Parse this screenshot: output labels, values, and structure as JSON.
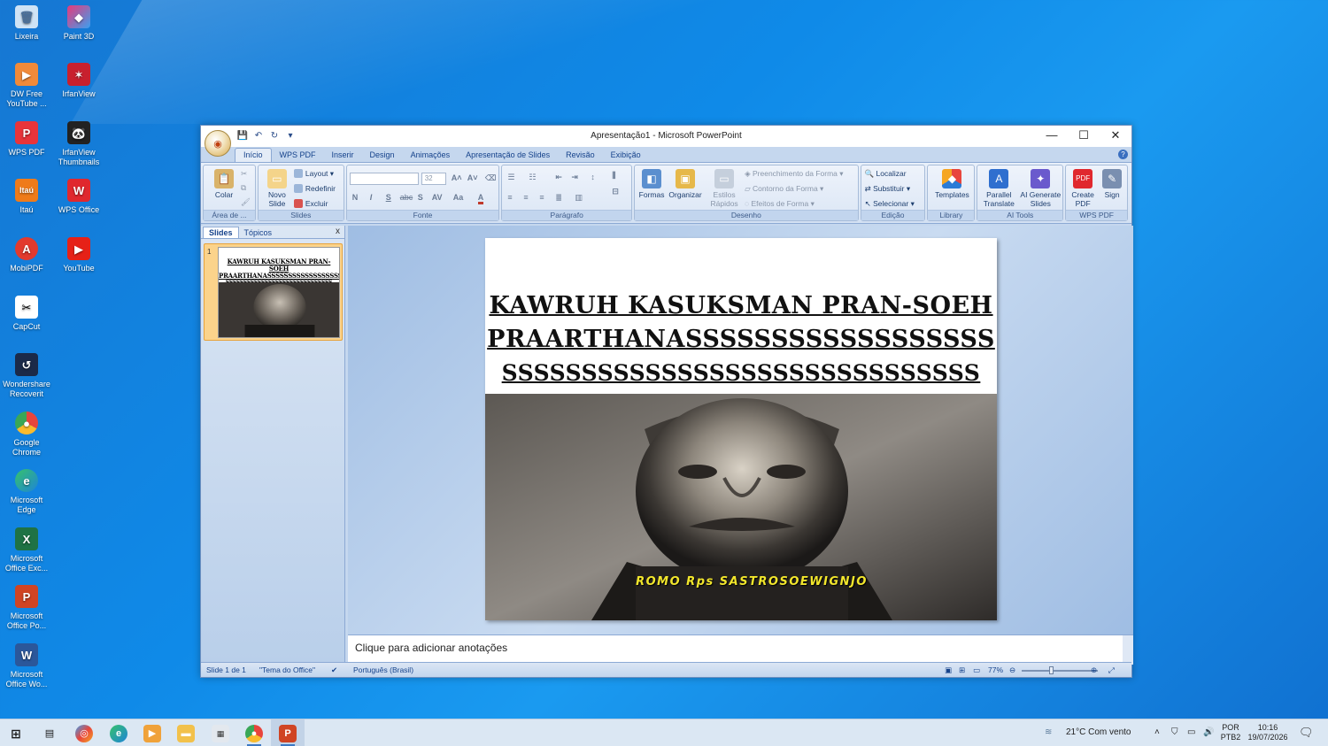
{
  "desktop": {
    "icons": [
      {
        "label": "Lixeira"
      },
      {
        "label": "Paint 3D"
      },
      {
        "label": "DW Free YouTube ..."
      },
      {
        "label": "IrfanView"
      },
      {
        "label": "WPS PDF"
      },
      {
        "label": "IrfanView Thumbnails"
      },
      {
        "label": "Itaú"
      },
      {
        "label": "WPS Office"
      },
      {
        "label": "MobiPDF"
      },
      {
        "label": "YouTube"
      },
      {
        "label": "CapCut"
      },
      {
        "label": "Wondershare Recoverit"
      },
      {
        "label": "Google Chrome"
      },
      {
        "label": "Microsoft Edge"
      },
      {
        "label": "Microsoft Office Exc..."
      },
      {
        "label": "Microsoft Office Po..."
      },
      {
        "label": "Microsoft Office Wo..."
      }
    ]
  },
  "window": {
    "title": "Apresentação1 - Microsoft PowerPoint",
    "controls": {
      "minimize": "—",
      "maximize": "☐",
      "close": "✕"
    }
  },
  "ribbon_tabs": [
    "Início",
    "WPS PDF",
    "Inserir",
    "Design",
    "Animações",
    "Apresentação de Slides",
    "Revisão",
    "Exibição"
  ],
  "ribbon": {
    "clipboard": {
      "paste": "Colar",
      "group": "Área de ..."
    },
    "slides": {
      "new_slide": "Novo Slide",
      "layout": "Layout",
      "reset": "Redefinir",
      "delete": "Excluir",
      "group": "Slides"
    },
    "font": {
      "size": "32",
      "group": "Fonte",
      "bold": "N",
      "italic": "I",
      "underline": "S",
      "strike": "abc",
      "shadow": "S",
      "spacing": "AV",
      "case": "Aa"
    },
    "paragraph": {
      "group": "Parágrafo"
    },
    "drawing": {
      "shapes": "Formas",
      "arrange": "Organizar",
      "quick_styles": "Estilos Rápidos",
      "fill": "Preenchimento da Forma",
      "outline": "Contorno da Forma",
      "effects": "Efeitos de Forma",
      "group": "Desenho"
    },
    "editing": {
      "find": "Localizar",
      "replace": "Substituir",
      "select": "Selecionar",
      "group": "Edição"
    },
    "library": {
      "templates": "Templates",
      "group": "Library"
    },
    "ai_tools": {
      "parallel": "Parallel Translate",
      "ai_generate": "AI Generate Slides",
      "group": "AI Tools"
    },
    "wps_pdf": {
      "create": "Create PDF",
      "sign": "Sign",
      "group": "WPS PDF"
    }
  },
  "left_pane": {
    "tab_slides": "Slides",
    "tab_outline": "Tópicos",
    "close": "x",
    "slide_number": "1"
  },
  "slide": {
    "title_lines": [
      "KAWRUH KASUKSMAN PRAN-SOEH",
      "PRAARTHANASSSSSSSSSSSSSSSSSS",
      "SSSSSSSSSSSSSSSSSSSSSSSSSSSSSS"
    ],
    "caption": "ROMO Rps  SASTROSOEWIGNJO"
  },
  "notes": {
    "placeholder": "Clique para adicionar anotações"
  },
  "statusbar": {
    "slide": "Slide 1 de 1",
    "theme": "\"Tema do Office\"",
    "language": "Português (Brasil)",
    "zoom": "77%",
    "zoom_level": 0.4
  },
  "taskbar": {
    "weather": "21°C  Com vento",
    "lang_top": "POR",
    "lang_bottom": "PTB2",
    "time": "10:16",
    "date": "19/07/2026"
  }
}
